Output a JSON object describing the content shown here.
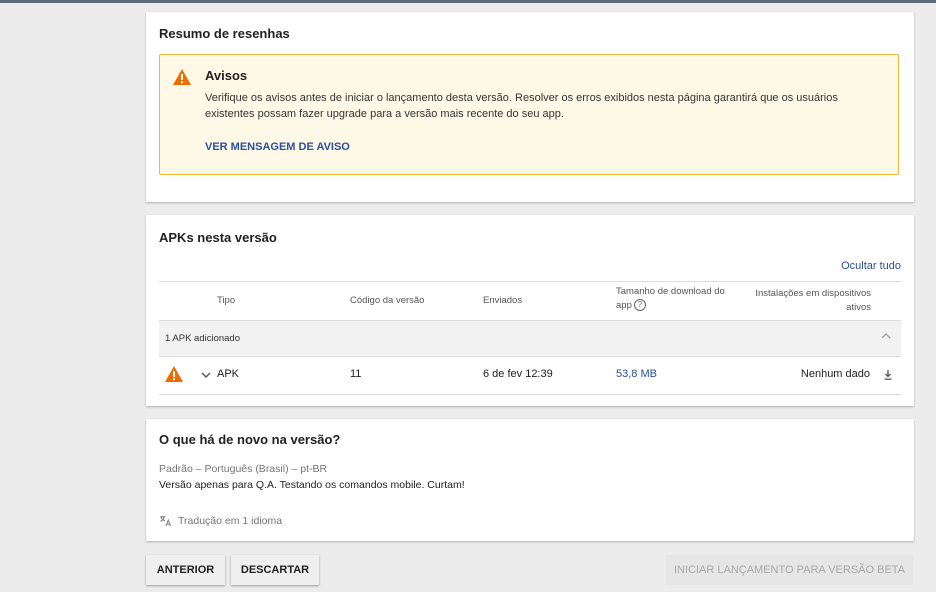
{
  "summary": {
    "title": "Resumo de resenhas",
    "warning": {
      "title": "Avisos",
      "text": "Verifique os avisos antes de iniciar o lançamento desta versão. Resolver os erros exibidos nesta página garantirá que os usuários existentes possam fazer upgrade para a versão mais recente do seu app.",
      "link": "VER MENSAGEM DE AVISO"
    }
  },
  "apks": {
    "title": "APKs nesta versão",
    "hide_all": "Ocultar tudo",
    "columns": {
      "type": "Tipo",
      "version_code": "Código da versão",
      "sent": "Enviados",
      "download_size": "Tamanho de download do app",
      "installs": "Instalações em dispositivos ativos"
    },
    "group_label": "1 APK adicionado",
    "rows": [
      {
        "type": "APK",
        "version_code": "11",
        "sent": "6 de fev 12:39",
        "download_size": "53,8 MB",
        "installs": "Nenhum dado"
      }
    ]
  },
  "whats_new": {
    "title": "O que há de novo na versão?",
    "language": "Padrão – Português (Brasil) – pt-BR",
    "notes": "Versão apenas para Q.A. Testando os comandos mobile. Curtam!",
    "translation": "Tradução em 1 idioma"
  },
  "buttons": {
    "back": "ANTERIOR",
    "discard": "DESCARTAR",
    "launch": "INICIAR LANÇAMENTO PARA VERSÃO BETA"
  },
  "colors": {
    "warning_icon": "#ef6c00",
    "link": "#2b4f9e",
    "warning_bg": "#fef9e6",
    "warning_border": "#f0b93b"
  },
  "icons": {
    "warning": "warning-triangle-icon",
    "help": "help-circle-icon",
    "expand": "chevron-down-icon",
    "collapse": "chevron-up-icon",
    "download": "download-icon",
    "translate": "translate-icon"
  }
}
